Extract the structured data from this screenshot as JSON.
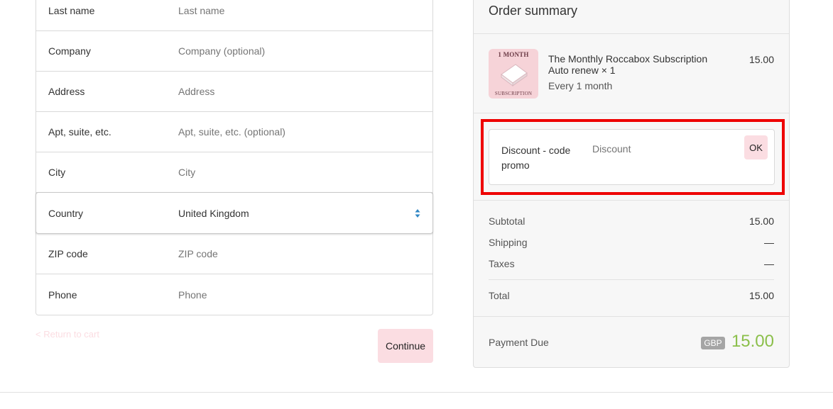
{
  "form": {
    "fields": [
      {
        "label": "Last name",
        "placeholder": "Last name"
      },
      {
        "label": "Company",
        "placeholder": "Company (optional)"
      },
      {
        "label": "Address",
        "placeholder": "Address"
      },
      {
        "label": "Apt, suite, etc.",
        "placeholder": "Apt, suite, etc. (optional)"
      },
      {
        "label": "City",
        "placeholder": "City"
      },
      {
        "label": "Country",
        "value": "United Kingdom"
      },
      {
        "label": "ZIP code",
        "placeholder": "ZIP code"
      },
      {
        "label": "Phone",
        "placeholder": "Phone"
      }
    ],
    "return_link": "< Return to cart",
    "continue_label": "Continue"
  },
  "summary": {
    "title": "Order summary",
    "product": {
      "thumb_top": "1 MONTH",
      "thumb_bottom": "SUBSCRIPTION",
      "name": "The Monthly Roccabox Subscription Auto renew × 1",
      "frequency": "Every 1 month",
      "price": "15.00"
    },
    "discount": {
      "label": "Discount - code promo",
      "placeholder": "Discount",
      "button": "OK"
    },
    "subtotal_label": "Subtotal",
    "subtotal_value": "15.00",
    "shipping_label": "Shipping",
    "shipping_value": "—",
    "taxes_label": "Taxes",
    "taxes_value": "—",
    "total_label": "Total",
    "total_value": "15.00",
    "payment_due_label": "Payment Due",
    "currency": "GBP",
    "payment_due_value": "15.00"
  },
  "colors": {
    "accent_pink": "#fbdde2",
    "highlight_red": "#ee0000",
    "due_green": "#8bbf4a"
  },
  "icons": {
    "select_arrows": "select-arrows-icon"
  }
}
